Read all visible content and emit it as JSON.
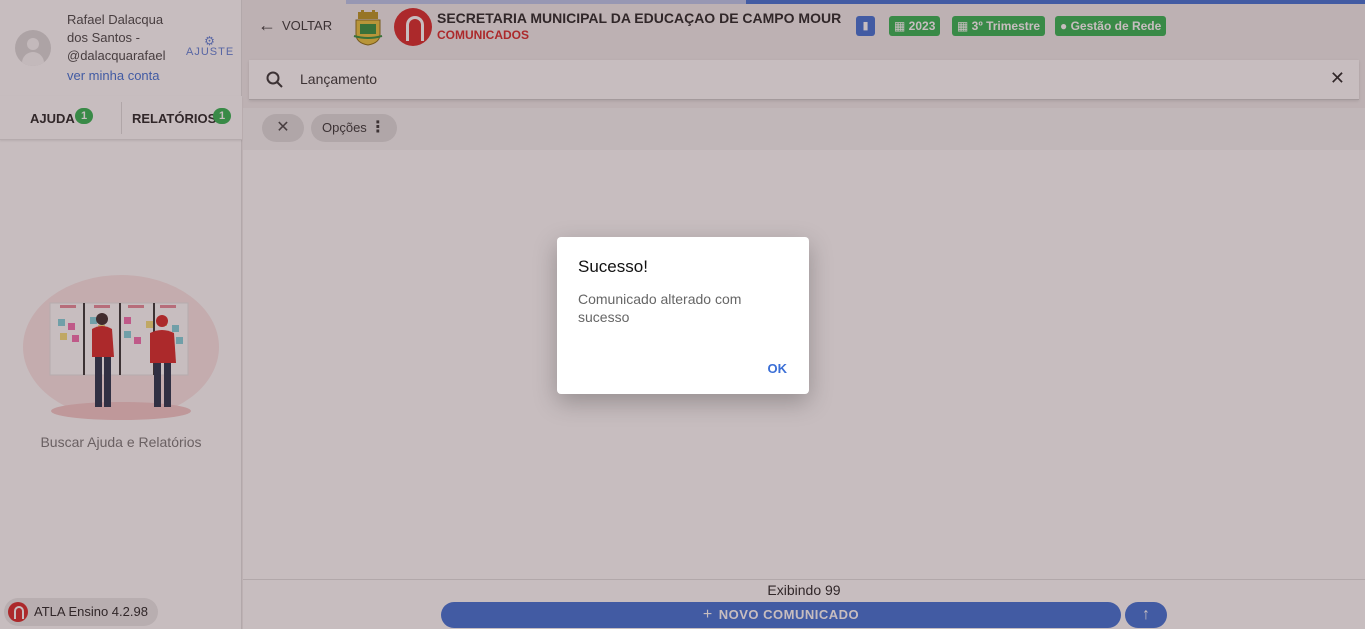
{
  "user": {
    "name": "Rafael Dalacqua dos Santos - @dalacquarafael",
    "account_link": "ver minha conta",
    "settings_label": "AJUSTE"
  },
  "sidebar": {
    "tabs": [
      {
        "label": "AJUDA",
        "badge": "1"
      },
      {
        "label": "RELATÓRIOS",
        "badge": "1"
      }
    ],
    "help_text": "Buscar Ajuda e Relatórios",
    "version": "ATLA Ensino 4.2.98"
  },
  "header": {
    "back_label": "VOLTAR",
    "title": "SECRETARIA MUNICIPAL DA EDUCAÇAO DE CAMPO MOUR",
    "subtitle": "COMUNICADOS",
    "chips": [
      "2023",
      "3º Trimestre",
      "Gestão de Rede"
    ]
  },
  "search": {
    "value": "Lançamento"
  },
  "filters": {
    "options_label": "Opções"
  },
  "footer": {
    "count_label": "Exibindo 99",
    "new_button": "NOVO COMUNICADO"
  },
  "dialog": {
    "title": "Sucesso!",
    "message": "Comunicado alterado com sucesso",
    "ok_label": "OK"
  },
  "colors": {
    "brand_red": "#d82525",
    "accent_blue": "#3b6fd6",
    "success_green": "#2eb44f"
  }
}
